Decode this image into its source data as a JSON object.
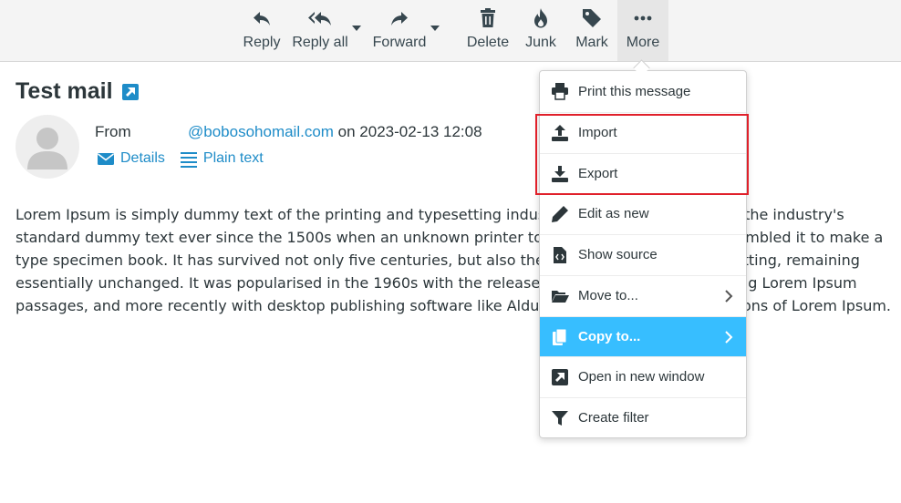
{
  "toolbar": {
    "buttons": [
      {
        "label": "Reply",
        "icon": "reply-icon"
      },
      {
        "label": "Reply all",
        "icon": "reply-all-icon"
      },
      {
        "label": "Forward",
        "icon": "forward-icon"
      },
      {
        "label": "Delete",
        "icon": "trash-icon"
      },
      {
        "label": "Junk",
        "icon": "fire-icon"
      },
      {
        "label": "Mark",
        "icon": "tag-icon"
      },
      {
        "label": "More",
        "icon": "more-dots-icon"
      }
    ]
  },
  "message": {
    "subject": "Test mail",
    "from_label": "From",
    "from_email": "@bobosohomail.com",
    "date_text": " on 2023-02-13 12:08",
    "details_label": "Details",
    "plain_text_label": "Plain text",
    "body": "Lorem Ipsum is simply dummy text of the printing and typesetting industry. Lorem Ipsum has been the industry's standard dummy text ever since the 1500s when an unknown printer took a galley of type and scrambled it to make a type specimen book. It has survived not only five centuries, but also the leap into electronic typesetting, remaining essentially unchanged. It was popularised in the 1960s with the release of Letraset sheets containing Lorem Ipsum passages, and more recently with desktop publishing software like Aldus PageMaker including versions of Lorem Ipsum."
  },
  "more_menu": {
    "items": [
      {
        "label": "Print this message",
        "icon": "print-icon"
      },
      {
        "label": "Import",
        "icon": "upload-icon"
      },
      {
        "label": "Export",
        "icon": "download-icon"
      },
      {
        "label": "Edit as new",
        "icon": "pencil-icon"
      },
      {
        "label": "Show source",
        "icon": "file-code-icon"
      },
      {
        "label": "Move to...",
        "icon": "folder-open-icon"
      },
      {
        "label": "Copy to...",
        "icon": "copy-icon"
      },
      {
        "label": "Open in new window",
        "icon": "external-link-icon"
      },
      {
        "label": "Create filter",
        "icon": "filter-icon"
      }
    ],
    "highlighted_item": "Copy to..."
  },
  "colors": {
    "accent": "#37beff",
    "link": "#1e8cc8",
    "annotation_box": "#e0202a"
  }
}
